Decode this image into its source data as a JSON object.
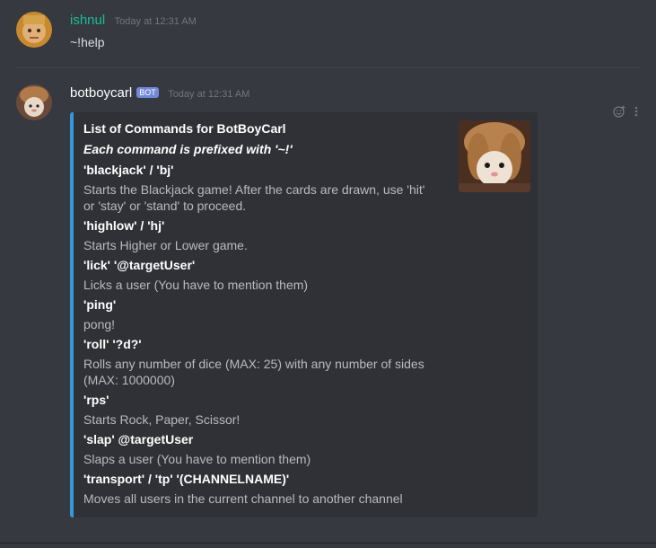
{
  "messages": [
    {
      "username": "ishnul",
      "username_color": "#1abc9c",
      "timestamp": "Today at 12:31 AM",
      "text": "~!help"
    },
    {
      "username": "botboycarl",
      "username_color": "#ffffff",
      "bot_tag": "BOT",
      "timestamp": "Today at 12:31 AM",
      "embed": {
        "accent_color": "#3498db",
        "title": "List of Commands for BotBoyCarl",
        "description": "Each command is prefixed with '~!'",
        "fields": [
          {
            "name": "'blackjack' / 'bj'",
            "value": "Starts the Blackjack game! After the cards are drawn, use 'hit' or 'stay' or 'stand' to proceed."
          },
          {
            "name": "'highlow' / 'hj'",
            "value": "Starts Higher or Lower game."
          },
          {
            "name": "'lick' '@targetUser'",
            "value": "Licks a user (You have to mention them)"
          },
          {
            "name": "'ping'",
            "value": "pong!"
          },
          {
            "name": "'roll' '?d?'",
            "value": "Rolls any number of dice (MAX: 25) with any number of sides (MAX: 1000000)"
          },
          {
            "name": "'rps'",
            "value": "Starts Rock, Paper, Scissor!"
          },
          {
            "name": "'slap' @targetUser",
            "value": "Slaps a user (You have to mention them)"
          },
          {
            "name": "'transport' / 'tp' '(CHANNELNAME)'",
            "value": "Moves all users in the current channel to another channel"
          }
        ]
      }
    }
  ],
  "icons": {
    "reaction": "add-reaction-icon",
    "more": "more-options-icon"
  }
}
